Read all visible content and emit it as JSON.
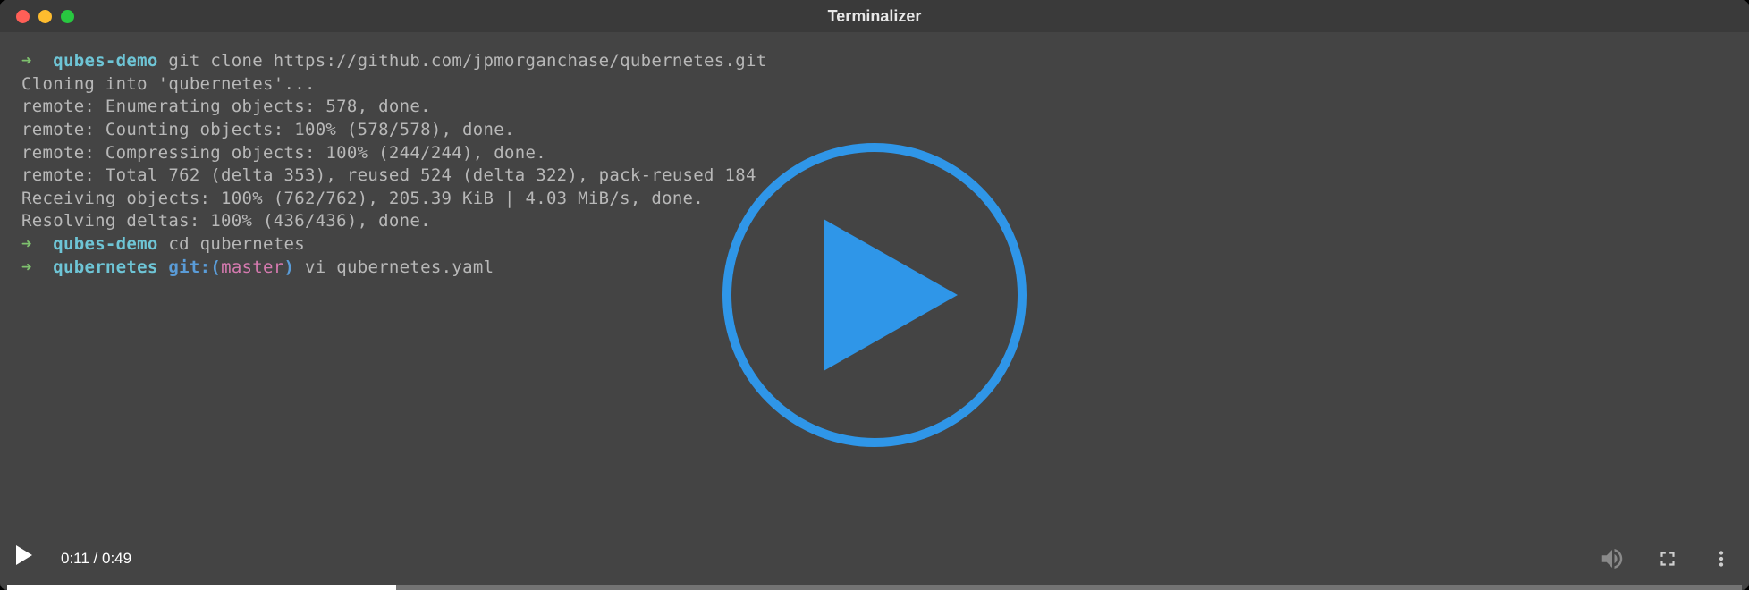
{
  "window": {
    "title": "Terminalizer"
  },
  "terminal": {
    "lines": [
      {
        "type": "prompt1",
        "arrow": "➜",
        "dir": "qubes-demo",
        "cmd": "git clone https://github.com/jpmorganchase/qubernetes.git"
      },
      {
        "type": "output",
        "text": "Cloning into 'qubernetes'..."
      },
      {
        "type": "output",
        "text": "remote: Enumerating objects: 578, done."
      },
      {
        "type": "output",
        "text": "remote: Counting objects: 100% (578/578), done."
      },
      {
        "type": "output",
        "text": "remote: Compressing objects: 100% (244/244), done."
      },
      {
        "type": "output",
        "text": "remote: Total 762 (delta 353), reused 524 (delta 322), pack-reused 184"
      },
      {
        "type": "output",
        "text": "Receiving objects: 100% (762/762), 205.39 KiB | 4.03 MiB/s, done."
      },
      {
        "type": "output",
        "text": "Resolving deltas: 100% (436/436), done."
      },
      {
        "type": "prompt1",
        "arrow": "➜",
        "dir": "qubes-demo",
        "cmd": "cd qubernetes"
      },
      {
        "type": "prompt2",
        "arrow": "➜",
        "dir": "qubernetes",
        "git_label": "git:(",
        "branch": "master",
        "git_close": ")",
        "cmd": "vi qubernetes.yaml"
      }
    ]
  },
  "video": {
    "current_time": "0:11",
    "separator": " / ",
    "total_time": "0:49",
    "progress_percent": 22.4
  }
}
